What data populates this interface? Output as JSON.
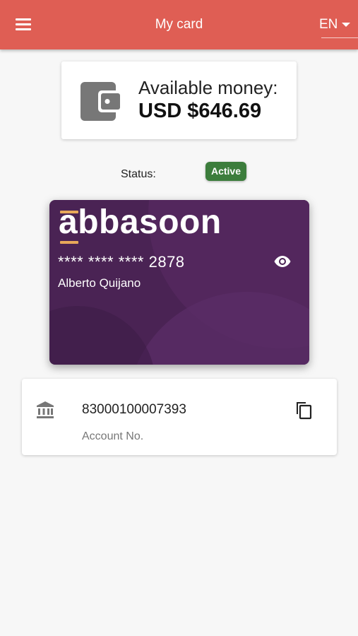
{
  "header": {
    "title": "My card",
    "language": "EN"
  },
  "balance": {
    "label": "Available money:",
    "amount": "USD $646.69"
  },
  "status": {
    "label": "Status:",
    "value": "Active"
  },
  "card": {
    "brand": "abbasoon",
    "number_mask": "**** **** ****",
    "last4": "2878",
    "holder": "Alberto Quijano"
  },
  "account": {
    "number": "83000100007393",
    "label": "Account No."
  },
  "colors": {
    "appbar": "#df5e54",
    "card_bg": "#4a2354",
    "status_bg": "#3c7d3c",
    "brand_accent": "#e8a85a"
  }
}
